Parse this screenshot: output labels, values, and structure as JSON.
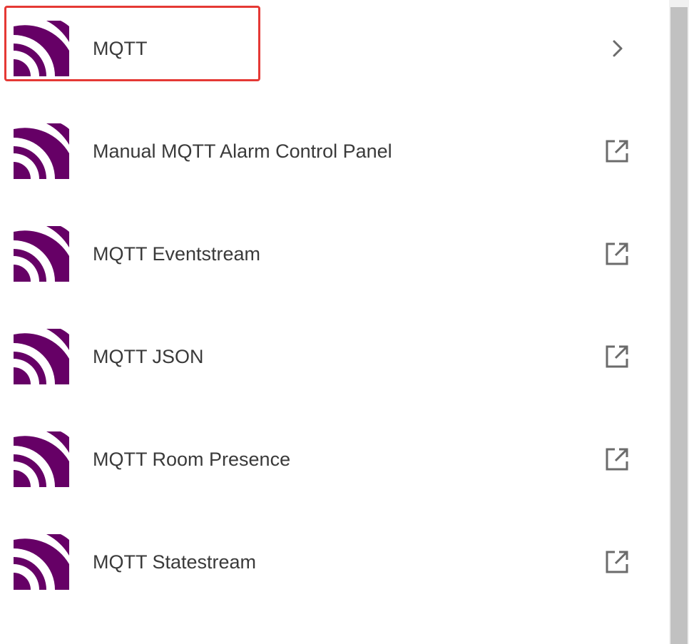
{
  "colors": {
    "brand_purple": "#660066",
    "highlight_red": "#e53935",
    "text": "#3a3a3a",
    "icon_gray": "#6b6b6b"
  },
  "integrations": [
    {
      "label": "MQTT",
      "logo_icon": "mqtt-logo-icon",
      "action_icon": "chevron-right-icon"
    },
    {
      "label": "Manual MQTT Alarm Control Panel",
      "logo_icon": "mqtt-logo-icon",
      "action_icon": "open-in-new-icon"
    },
    {
      "label": "MQTT Eventstream",
      "logo_icon": "mqtt-logo-icon",
      "action_icon": "open-in-new-icon"
    },
    {
      "label": "MQTT JSON",
      "logo_icon": "mqtt-logo-icon",
      "action_icon": "open-in-new-icon"
    },
    {
      "label": "MQTT Room Presence",
      "logo_icon": "mqtt-logo-icon",
      "action_icon": "open-in-new-icon"
    },
    {
      "label": "MQTT Statestream",
      "logo_icon": "mqtt-logo-icon",
      "action_icon": "open-in-new-icon"
    }
  ]
}
